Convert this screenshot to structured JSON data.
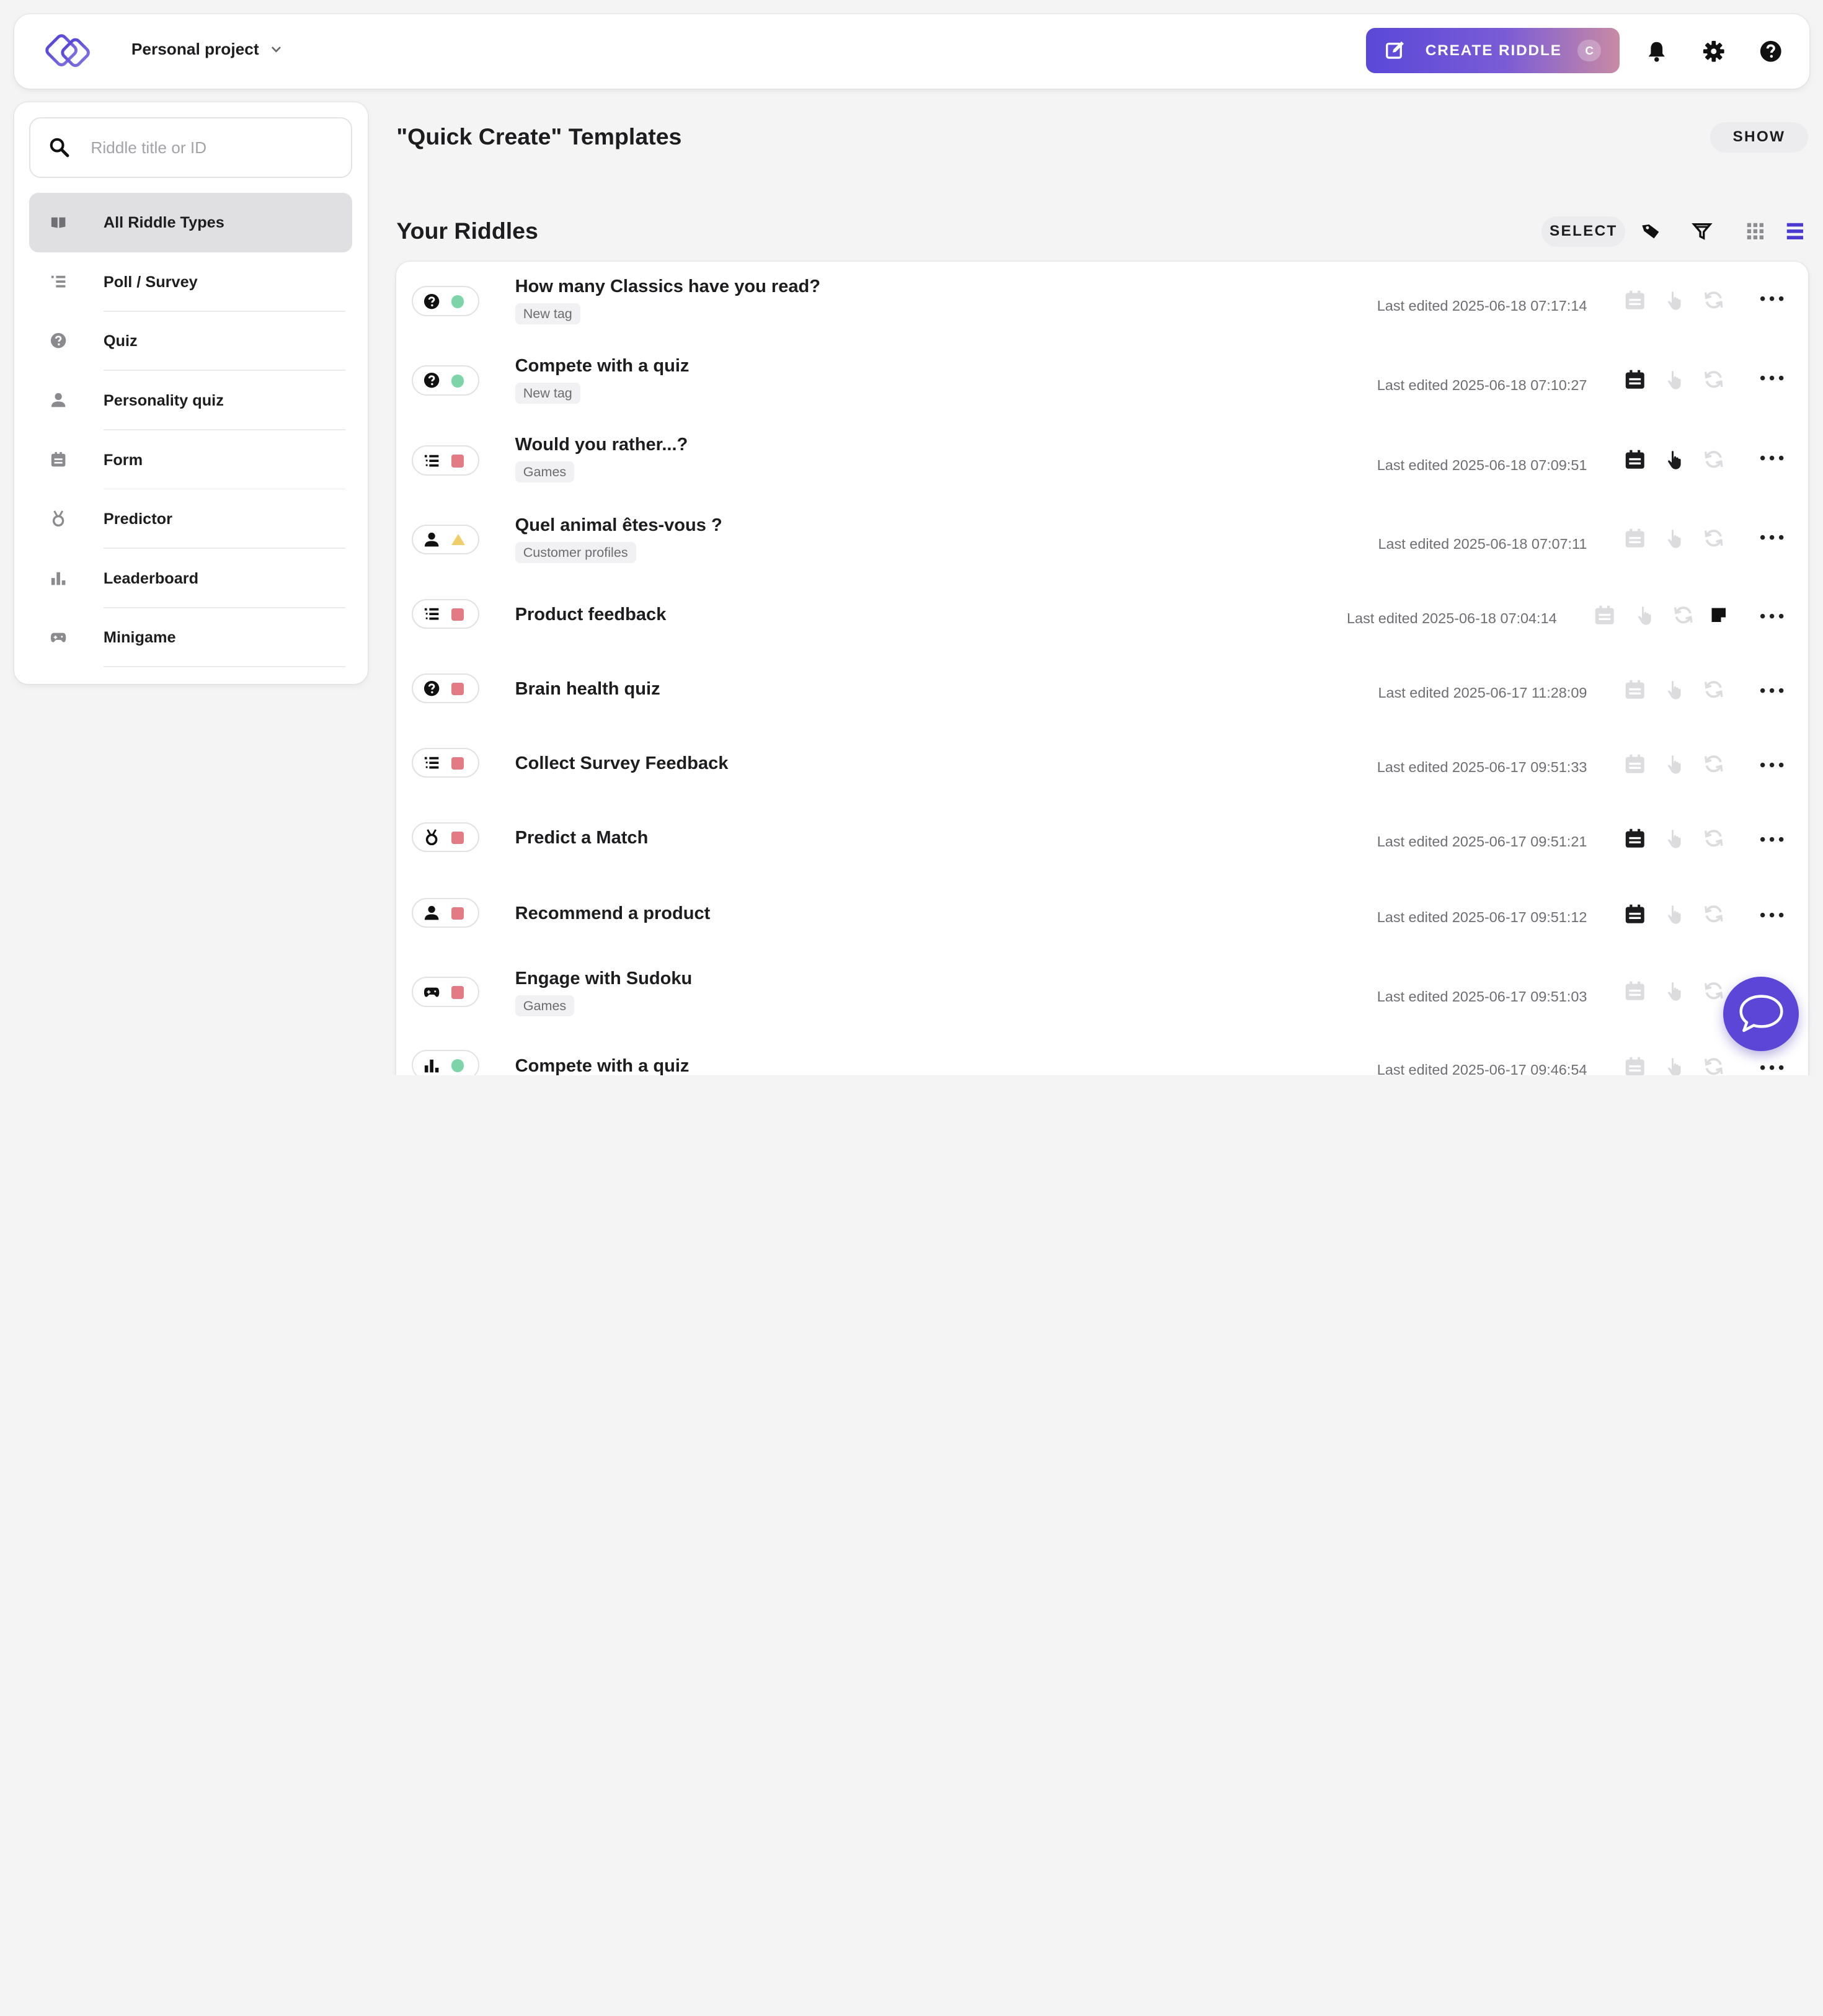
{
  "header": {
    "project_label": "Personal project",
    "create_label": "CREATE RIDDLE",
    "create_shortcut": "C"
  },
  "sidebar": {
    "search_placeholder": "Riddle title or ID",
    "items": [
      {
        "label": "All Riddle Types",
        "icon": "book-icon",
        "active": true
      },
      {
        "label": "Poll / Survey",
        "icon": "list-icon",
        "active": false
      },
      {
        "label": "Quiz",
        "icon": "question-icon",
        "active": false
      },
      {
        "label": "Personality quiz",
        "icon": "person-icon",
        "active": false
      },
      {
        "label": "Form",
        "icon": "form-icon",
        "active": false
      },
      {
        "label": "Predictor",
        "icon": "medal-icon",
        "active": false
      },
      {
        "label": "Leaderboard",
        "icon": "bar-chart-icon",
        "active": false
      },
      {
        "label": "Minigame",
        "icon": "gamepad-icon",
        "active": false
      }
    ]
  },
  "main": {
    "templates_title": "\"Quick Create\" Templates",
    "show_label": "SHOW",
    "riddles_title": "Your Riddles",
    "select_label": "SELECT"
  },
  "riddles": [
    {
      "title": "How many Classics have you read?",
      "tag": "New tag",
      "edited": "Last edited 2025-06-18 07:17:14",
      "type_icon": "question-icon",
      "status": "green"
    },
    {
      "title": "Compete with a quiz",
      "tag": "New tag",
      "edited": "Last edited 2025-06-18 07:10:27",
      "type_icon": "question-icon",
      "status": "green"
    },
    {
      "title": "Would you rather...?",
      "tag": "Games",
      "edited": "Last edited 2025-06-18 07:09:51",
      "type_icon": "list-icon",
      "status": "red"
    },
    {
      "title": "Quel animal êtes-vous ?",
      "tag": "Customer profiles",
      "edited": "Last edited 2025-06-18 07:07:11",
      "type_icon": "person-icon",
      "status": "warning"
    },
    {
      "title": "Product feedback",
      "tag": "",
      "edited": "Last edited 2025-06-18 07:04:14",
      "type_icon": "list-icon",
      "status": "red"
    },
    {
      "title": "Brain health quiz",
      "tag": "",
      "edited": "Last edited 2025-06-17 11:28:09",
      "type_icon": "question-icon",
      "status": "red"
    },
    {
      "title": "Collect Survey Feedback",
      "tag": "",
      "edited": "Last edited 2025-06-17 09:51:33",
      "type_icon": "list-icon",
      "status": "red"
    },
    {
      "title": "Predict a Match",
      "tag": "",
      "edited": "Last edited 2025-06-17 09:51:21",
      "type_icon": "medal-icon",
      "status": "red"
    },
    {
      "title": "Recommend a product",
      "tag": "",
      "edited": "Last edited 2025-06-17 09:51:12",
      "type_icon": "person-icon",
      "status": "red"
    },
    {
      "title": "Engage with Sudoku",
      "tag": "Games",
      "edited": "Last edited 2025-06-17 09:51:03",
      "type_icon": "gamepad-icon",
      "status": "red"
    },
    {
      "title": "Compete with a quiz",
      "tag": "",
      "edited": "Last edited 2025-06-17 09:46:54",
      "type_icon": "bar-chart-icon",
      "status": "green"
    }
  ],
  "colors": {
    "accent": "#5a48d8",
    "status_green": "#7dd4a6",
    "status_red": "#e27b84",
    "status_warning": "#f0cf6a"
  }
}
